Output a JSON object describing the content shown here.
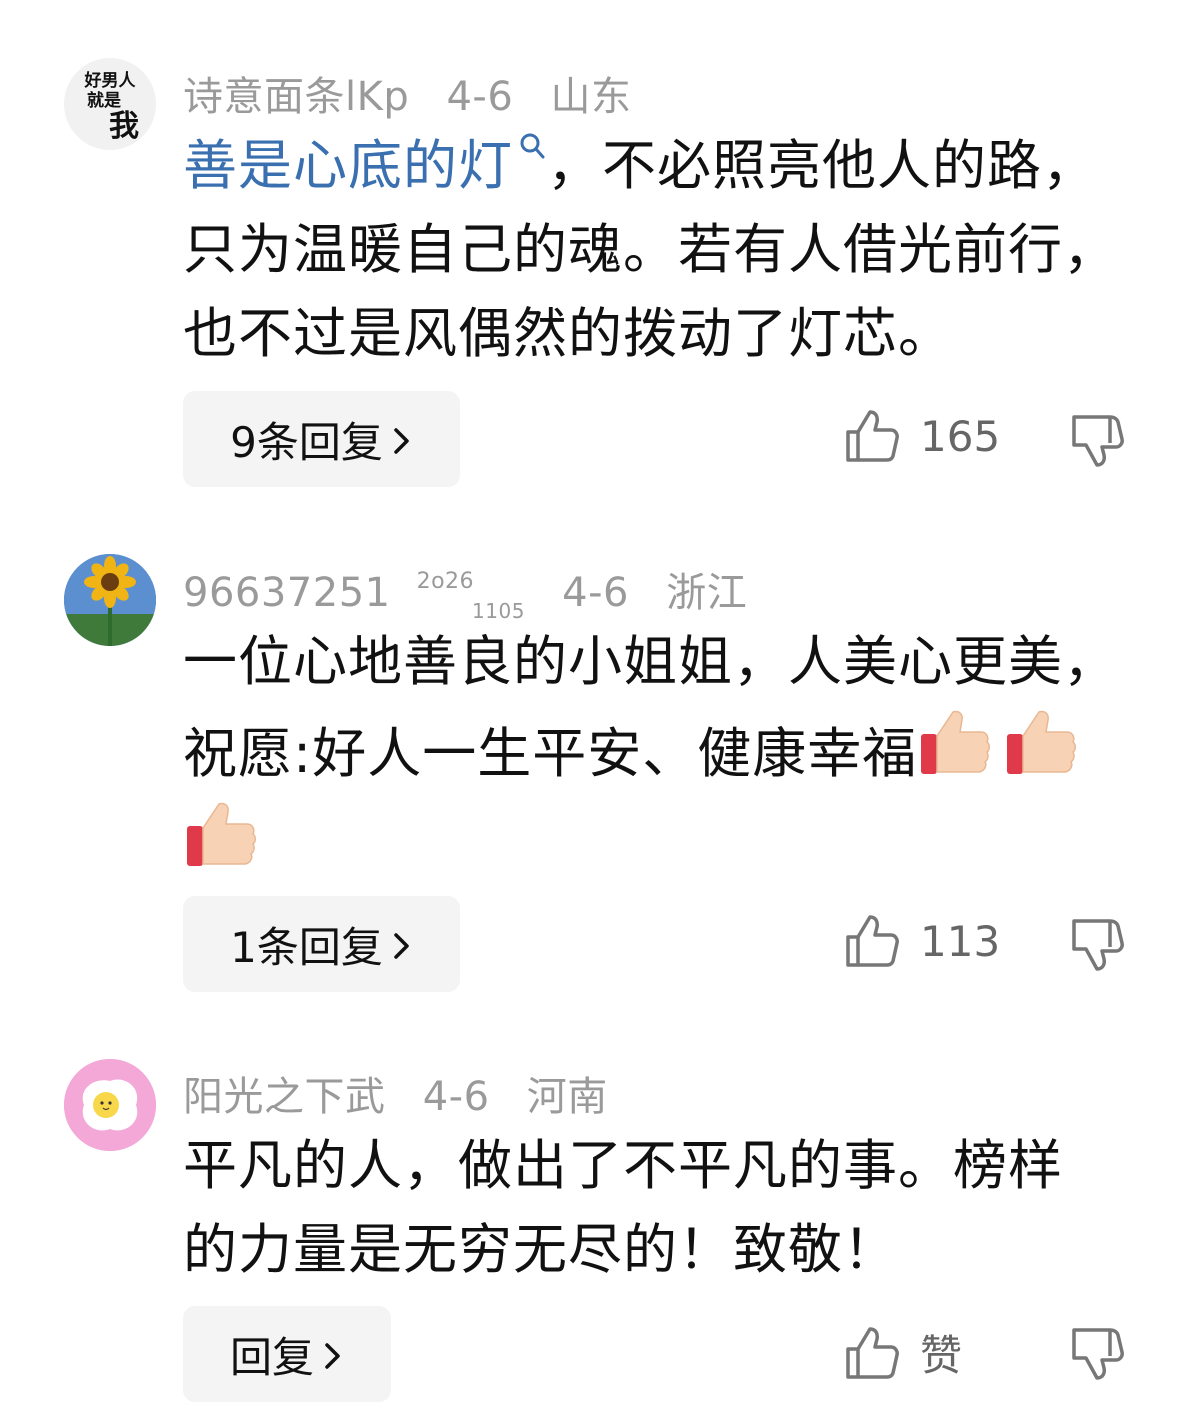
{
  "comments": [
    {
      "username": "诗意面条lKp",
      "date": "4-6",
      "location": "山东",
      "avatar_text": [
        "好男人",
        "就是",
        "我"
      ],
      "link_text": "善是心底的灯",
      "body_lines": [
        "，不必照亮他人的路，",
        "只为温暖自己的魂。若有人借光前行，",
        "也不过是风偶然的拨动了灯芯。"
      ],
      "reply_label": "9条回复",
      "likes": "165"
    },
    {
      "username_main": "96637251",
      "username_sup": "2o26",
      "username_sub": "1105",
      "date": "4-6",
      "location": "浙江",
      "body_lines": [
        "一位心地善良的小姐姐，人美心更美，",
        "祝愿:好人一生平安、健康幸福"
      ],
      "reply_label": "1条回复",
      "likes": "113"
    },
    {
      "username": "阳光之下武",
      "date": "4-6",
      "location": "河南",
      "body_lines": [
        "平凡的人，做出了不平凡的事。榜样",
        "的力量是无穷无尽的！致敬！"
      ],
      "reply_label": "回复",
      "likes": "赞"
    }
  ],
  "colors": {
    "link": "#3a6fb0",
    "meta": "#9a9a9a",
    "button_bg": "#f4f4f4"
  }
}
